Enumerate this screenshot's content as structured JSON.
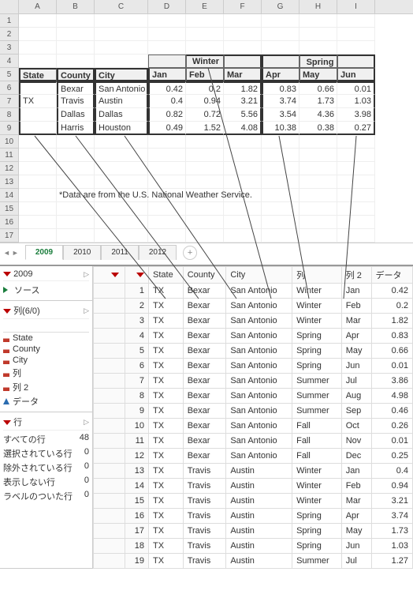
{
  "excel": {
    "columns": [
      "A",
      "B",
      "C",
      "D",
      "E",
      "F",
      "G",
      "H",
      "I"
    ],
    "row_labels": [
      "1",
      "2",
      "3",
      "4",
      "5",
      "6",
      "7",
      "8",
      "9",
      "10",
      "11",
      "12",
      "13",
      "14",
      "15",
      "16",
      "17"
    ],
    "seasons": {
      "winter": "Winter",
      "spring": "Spring"
    },
    "headers": {
      "state": "State",
      "county": "County",
      "city": "City",
      "months": [
        "Jan",
        "Feb",
        "Mar",
        "Apr",
        "May",
        "Jun"
      ]
    },
    "state": "TX",
    "rows": [
      {
        "county": "Bexar",
        "city": "San Antonio",
        "vals": [
          "0.42",
          "0.2",
          "1.82",
          "0.83",
          "0.66",
          "0.01"
        ]
      },
      {
        "county": "Travis",
        "city": "Austin",
        "vals": [
          "0.4",
          "0.94",
          "3.21",
          "3.74",
          "1.73",
          "1.03"
        ]
      },
      {
        "county": "Dallas",
        "city": "Dallas",
        "vals": [
          "0.82",
          "0.72",
          "5.56",
          "3.54",
          "4.36",
          "3.98"
        ]
      },
      {
        "county": "Harris",
        "city": "Houston",
        "vals": [
          "0.49",
          "1.52",
          "4.08",
          "10.38",
          "0.38",
          "0.27"
        ]
      }
    ],
    "footnote": "*Data are from the U.S. National Weather Service.",
    "tabs": [
      "2009",
      "2010",
      "2011",
      "2012"
    ],
    "active_tab": "2009"
  },
  "jmp": {
    "table_name": "2009",
    "source_label": "ソース",
    "columns_label": "列(6/0)",
    "search_placeholder": "",
    "cols": [
      {
        "name": "State",
        "type": "nom"
      },
      {
        "name": "County",
        "type": "nom"
      },
      {
        "name": "City",
        "type": "nom"
      },
      {
        "name": "列",
        "type": "nom"
      },
      {
        "name": "列 2",
        "type": "nom"
      },
      {
        "name": "データ",
        "type": "cont"
      }
    ],
    "rows_label": "行",
    "row_stats": [
      {
        "label": "すべての行",
        "value": "48"
      },
      {
        "label": "選択されている行",
        "value": "0"
      },
      {
        "label": "除外されている行",
        "value": "0"
      },
      {
        "label": "表示しない行",
        "value": "0"
      },
      {
        "label": "ラベルのついた行",
        "value": "0"
      }
    ],
    "grid_headers": [
      "State",
      "County",
      "City",
      "列",
      "列 2",
      "データ"
    ],
    "grid_rows": [
      [
        "TX",
        "Bexar",
        "San Antonio",
        "Winter",
        "Jan",
        "0.42"
      ],
      [
        "TX",
        "Bexar",
        "San Antonio",
        "Winter",
        "Feb",
        "0.2"
      ],
      [
        "TX",
        "Bexar",
        "San Antonio",
        "Winter",
        "Mar",
        "1.82"
      ],
      [
        "TX",
        "Bexar",
        "San Antonio",
        "Spring",
        "Apr",
        "0.83"
      ],
      [
        "TX",
        "Bexar",
        "San Antonio",
        "Spring",
        "May",
        "0.66"
      ],
      [
        "TX",
        "Bexar",
        "San Antonio",
        "Spring",
        "Jun",
        "0.01"
      ],
      [
        "TX",
        "Bexar",
        "San Antonio",
        "Summer",
        "Jul",
        "3.86"
      ],
      [
        "TX",
        "Bexar",
        "San Antonio",
        "Summer",
        "Aug",
        "4.98"
      ],
      [
        "TX",
        "Bexar",
        "San Antonio",
        "Summer",
        "Sep",
        "0.46"
      ],
      [
        "TX",
        "Bexar",
        "San Antonio",
        "Fall",
        "Oct",
        "0.26"
      ],
      [
        "TX",
        "Bexar",
        "San Antonio",
        "Fall",
        "Nov",
        "0.01"
      ],
      [
        "TX",
        "Bexar",
        "San Antonio",
        "Fall",
        "Dec",
        "0.25"
      ],
      [
        "TX",
        "Travis",
        "Austin",
        "Winter",
        "Jan",
        "0.4"
      ],
      [
        "TX",
        "Travis",
        "Austin",
        "Winter",
        "Feb",
        "0.94"
      ],
      [
        "TX",
        "Travis",
        "Austin",
        "Winter",
        "Mar",
        "3.21"
      ],
      [
        "TX",
        "Travis",
        "Austin",
        "Spring",
        "Apr",
        "3.74"
      ],
      [
        "TX",
        "Travis",
        "Austin",
        "Spring",
        "May",
        "1.73"
      ],
      [
        "TX",
        "Travis",
        "Austin",
        "Spring",
        "Jun",
        "1.03"
      ],
      [
        "TX",
        "Travis",
        "Austin",
        "Summer",
        "Jul",
        "1.27"
      ]
    ]
  }
}
